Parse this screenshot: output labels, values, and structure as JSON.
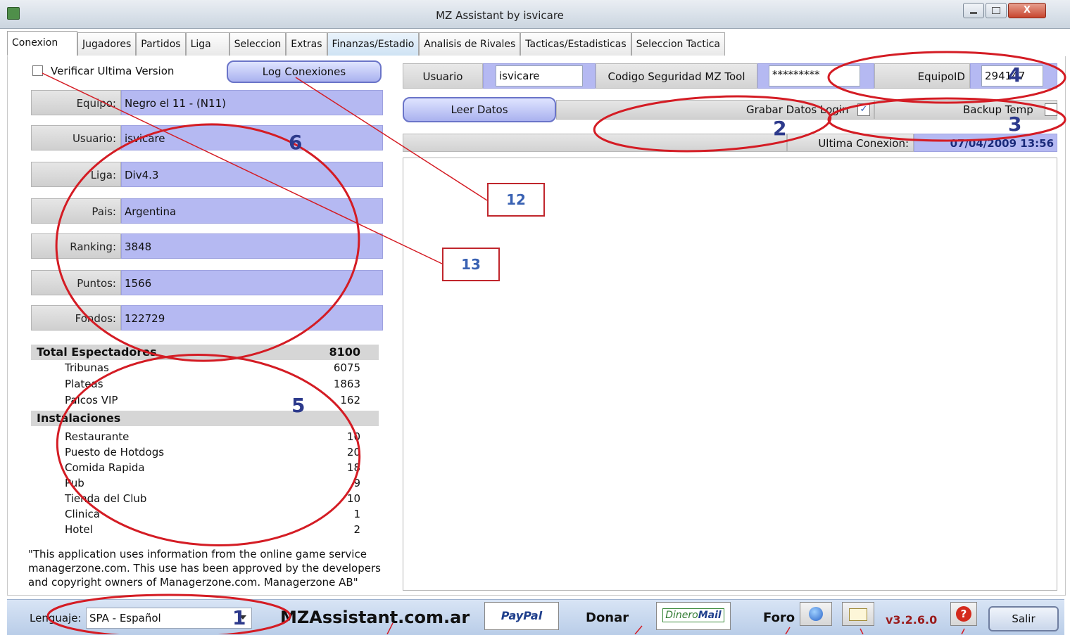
{
  "window": {
    "title": "MZ Assistant by isvicare",
    "close_glyph": "X"
  },
  "tabs": [
    "Conexion",
    "Jugadores",
    "Partidos",
    "Liga",
    "Seleccion",
    "Extras",
    "Finanzas/Estadio",
    "Analisis de Rivales",
    "Tacticas/Estadisticas",
    "Seleccion Tactica"
  ],
  "left": {
    "verify_label": "Verificar Ultima Version",
    "log_button": "Log Conexiones",
    "fields": [
      {
        "label": "Equipo:",
        "value": "Negro el 11 - (N11)"
      },
      {
        "label": "Usuario:",
        "value": "isvicare"
      },
      {
        "label": "Liga:",
        "value": "Div4.3"
      },
      {
        "label": "Pais:",
        "value": "Argentina"
      },
      {
        "label": "Ranking:",
        "value": "3848"
      },
      {
        "label": "Puntos:",
        "value": "1566"
      },
      {
        "label": "Fondos:",
        "value": "122729"
      }
    ],
    "stadium": {
      "total_label": "Total Espectadores",
      "total_value": "8100",
      "rows": [
        {
          "label": "Tribunas",
          "value": "6075"
        },
        {
          "label": "Plateas",
          "value": "1863"
        },
        {
          "label": "Palcos VIP",
          "value": "162"
        }
      ],
      "inst_label": "Instalaciones",
      "inst_rows": [
        {
          "label": "Restaurante",
          "value": "10"
        },
        {
          "label": "Puesto de Hotdogs",
          "value": "20"
        },
        {
          "label": "Comida Rapida",
          "value": "18"
        },
        {
          "label": "Pub",
          "value": "9"
        },
        {
          "label": "Tienda del Club",
          "value": "10"
        },
        {
          "label": "Clinica",
          "value": "1"
        },
        {
          "label": "Hotel",
          "value": "2"
        }
      ]
    },
    "disclaimer": "\"This application uses information from the online game service managerzone.com. This use has been approved by the developers and copyright owners of Managerzone.com. Managerzone AB\""
  },
  "right": {
    "usuario_label": "Usuario",
    "usuario_value": "isvicare",
    "codigo_label": "Codigo Seguridad MZ Tool",
    "codigo_value": "*********",
    "equipoid_label": "EquipoID",
    "equipoid_value": "294147",
    "leer_button": "Leer Datos",
    "grabar_label": "Grabar Datos Login",
    "grabar_check": "✓",
    "backup_label": "Backup Temp",
    "ultima_label": "Ultima Conexion:",
    "ultima_value": "07/04/2009 13:56"
  },
  "status": {
    "lang_label": "Lenguaje:",
    "lang_value": "SPA - Español",
    "site": "MZAssistant.com.ar",
    "paypal": "PayPal",
    "donar": "Donar",
    "dineromail_a": "Dinero",
    "dineromail_b": "Mail",
    "foro": "Foro",
    "version": "v3.2.6.0",
    "salir": "Salir"
  },
  "annotations": {
    "a1": "1",
    "a2": "2",
    "a3": "3",
    "a4": "4",
    "a5": "5",
    "a6": "6",
    "a12": "12",
    "a13": "13"
  },
  "icons": [
    "app-icon",
    "minimize-icon",
    "maximize-icon",
    "close-icon",
    "dropdown-arrow-icon",
    "globe-icon",
    "mail-icon",
    "help-icon"
  ]
}
